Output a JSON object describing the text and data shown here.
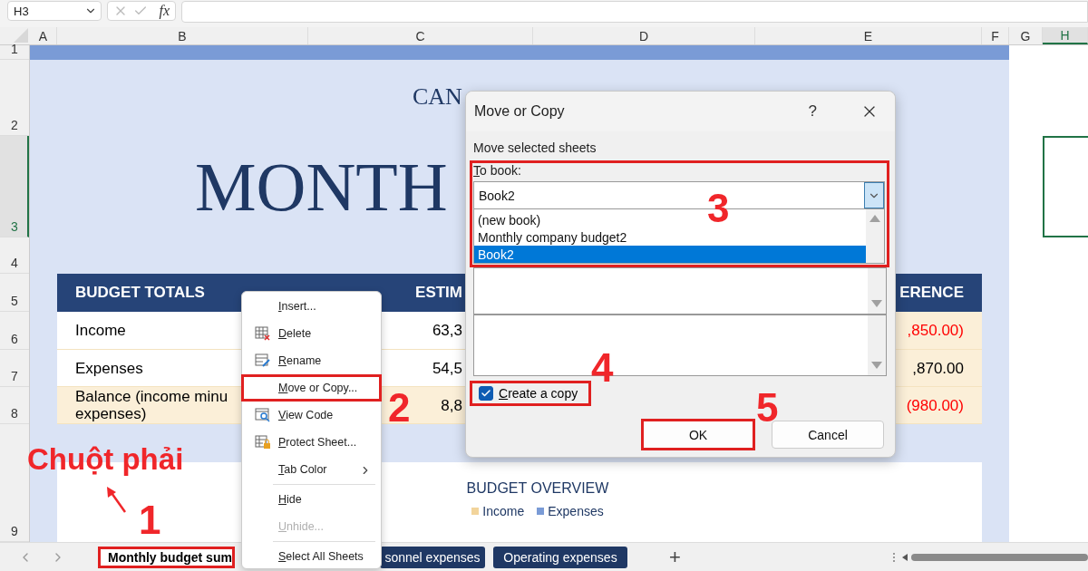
{
  "formula_bar": {
    "name_box": "H3",
    "function_label": "fx"
  },
  "columns": [
    {
      "label": "A",
      "selected": false
    },
    {
      "label": "B",
      "selected": false
    },
    {
      "label": "C",
      "selected": false
    },
    {
      "label": "D",
      "selected": false
    },
    {
      "label": "E",
      "selected": false
    },
    {
      "label": "F",
      "selected": false
    },
    {
      "label": "G",
      "selected": false
    },
    {
      "label": "H",
      "selected": true
    }
  ],
  "rows": [
    {
      "label": "1",
      "selected": false
    },
    {
      "label": "2",
      "selected": false
    },
    {
      "label": "3",
      "selected": true
    },
    {
      "label": "4",
      "selected": false
    },
    {
      "label": "5",
      "selected": false
    },
    {
      "label": "6",
      "selected": false
    },
    {
      "label": "7",
      "selected": false
    },
    {
      "label": "8",
      "selected": false
    },
    {
      "label": "9",
      "selected": false
    }
  ],
  "sheet": {
    "company": "CAN",
    "heading": "MONTH"
  },
  "budget_table": {
    "header": {
      "label": "BUDGET TOTALS",
      "estimated": "ESTIM",
      "difference": "ERENCE"
    },
    "rows": [
      {
        "kind": "line",
        "label": "Income",
        "estimated": "63,3",
        "difference": ",850.00)",
        "negative": true
      },
      {
        "kind": "line",
        "label": "Expenses",
        "estimated": "54,5",
        "difference": ",870.00",
        "negative": false
      },
      {
        "kind": "total",
        "label": "Balance (income minu expenses)",
        "estimated": "8,8",
        "difference": "(980.00)",
        "negative": true
      }
    ]
  },
  "chart": {
    "title": "BUDGET OVERVIEW",
    "legend": [
      {
        "label": "Income",
        "color": "#f2d49b"
      },
      {
        "label": "Expenses",
        "color": "#7a9bd6"
      }
    ]
  },
  "sheet_tabs": {
    "tabs": [
      {
        "label": "Monthly budget sum",
        "selected": true,
        "outlined": true
      },
      {
        "label": "sonnel expenses",
        "selected": false,
        "outlined": false
      },
      {
        "label": "Operating expenses",
        "selected": false,
        "outlined": false
      }
    ],
    "add_label": "+"
  },
  "context_menu": {
    "items": [
      {
        "kind": "item",
        "label": "Insert...",
        "disabled": false,
        "outlined": false
      },
      {
        "kind": "item",
        "label": "Delete",
        "disabled": false,
        "outlined": false
      },
      {
        "kind": "item",
        "label": "Rename",
        "disabled": false,
        "outlined": false
      },
      {
        "kind": "item",
        "label": "Move or Copy...",
        "disabled": false,
        "outlined": true
      },
      {
        "kind": "item",
        "label": "View Code",
        "disabled": false,
        "outlined": false
      },
      {
        "kind": "item",
        "label": "Protect Sheet...",
        "disabled": false,
        "outlined": false
      },
      {
        "kind": "submenu",
        "label": "Tab Color",
        "disabled": false,
        "outlined": false
      },
      {
        "kind": "separator"
      },
      {
        "kind": "item",
        "label": "Hide",
        "disabled": false,
        "outlined": false
      },
      {
        "kind": "item",
        "label": "Unhide...",
        "disabled": true,
        "outlined": false
      },
      {
        "kind": "separator"
      },
      {
        "kind": "item",
        "label": "Select All Sheets",
        "disabled": false,
        "outlined": false
      }
    ]
  },
  "dialog": {
    "title": "Move or Copy",
    "help": "?",
    "section_label": "Move selected sheets",
    "to_book": {
      "label": "To book:",
      "value": "Book2",
      "outlined": true,
      "expanded": true,
      "options": [
        {
          "label": "(new book)",
          "selected": false
        },
        {
          "label": "Monthly company budget2",
          "selected": false
        },
        {
          "label": "Book2",
          "selected": true
        }
      ]
    },
    "copy": {
      "label": "Create a copy",
      "checked": true,
      "outlined": true
    },
    "buttons": [
      {
        "label": "OK",
        "kind": "default",
        "outlined": true
      },
      {
        "label": "Cancel",
        "kind": "normal",
        "outlined": false
      }
    ]
  },
  "annotations": {
    "right_click_label": "Chuột phải",
    "steps": [
      "1",
      "2",
      "3",
      "4",
      "5"
    ]
  }
}
